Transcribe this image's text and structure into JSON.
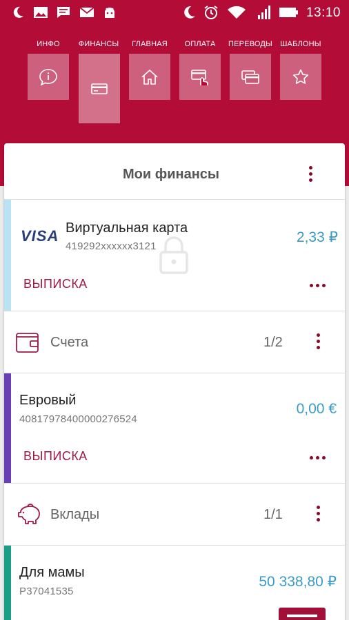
{
  "status_bar": {
    "time": "13:10",
    "left_icons": [
      "moon-icon",
      "image-icon",
      "chat-icon",
      "mail-icon",
      "android-icon"
    ],
    "right_icons": [
      "moon-icon",
      "alarm-icon",
      "wifi-icon",
      "signal-icon",
      "battery-icon"
    ]
  },
  "nav": {
    "items": [
      {
        "label": "ИНФО",
        "icon": "info-chat-icon",
        "active": false
      },
      {
        "label": "ФИНАНСЫ",
        "icon": "card-icon",
        "active": true
      },
      {
        "label": "ГЛАВНАЯ",
        "icon": "home-icon",
        "active": false
      },
      {
        "label": "ОПЛАТА",
        "icon": "payment-icon",
        "active": false
      },
      {
        "label": "ПЕРЕВОДЫ",
        "icon": "transfer-icon",
        "active": false
      },
      {
        "label": "ШАБЛОНЫ",
        "icon": "star-icon",
        "active": false
      }
    ]
  },
  "finances": {
    "title": "Мои финансы",
    "card": {
      "brand": "VISA",
      "name": "Виртуальная карта",
      "number": "419292xxxxxx3121",
      "amount": "2,33 ₽",
      "statement": "ВЫПИСКА",
      "stripe_color": "#b9e3f2"
    },
    "accounts_section": {
      "title": "Счета",
      "count": "1/2",
      "icon": "wallet-icon"
    },
    "account": {
      "name": "Евровый",
      "number": "40817978400000276524",
      "amount": "0,00 €",
      "statement": "ВЫПИСКА",
      "stripe_color": "#6a3fb5"
    },
    "deposits_section": {
      "title": "Вклады",
      "count": "1/1",
      "icon": "piggy-bank-icon"
    },
    "deposit": {
      "name": "Для мамы",
      "number": "Р37041535",
      "amount": "50 338,80 ₽",
      "stripe_color": "#1a9e85"
    }
  },
  "colors": {
    "brand": "#b30c36",
    "accent_dark": "#8a0a2e",
    "amount": "#3a9bc6"
  }
}
